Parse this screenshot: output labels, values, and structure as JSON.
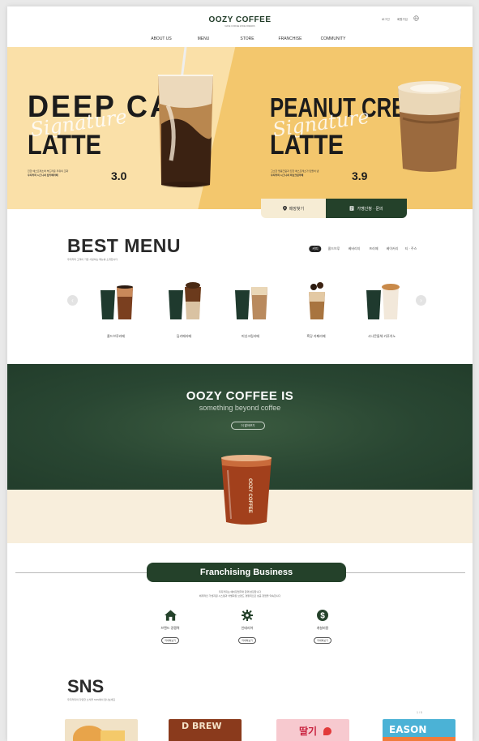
{
  "header": {
    "logo": "OOZY COFFEE",
    "logo_sub": "MAKE COFFEE ZONE FRIENDS",
    "util": [
      "로그인",
      "회원가입"
    ],
    "nav": [
      "ABOUT US",
      "MENU",
      "STORE",
      "FRANCHISE",
      "COMMUNITY"
    ]
  },
  "hero": {
    "slide1": {
      "title_line1": "DEEP CAFE",
      "title_line2": "LATTE",
      "script": "Signature",
      "desc_line1": "진한 에스프레소와 부드러운 우유의 조화",
      "desc_line2": "우지커피 시그니처 딥카페라떼",
      "price": "3.0"
    },
    "slide2": {
      "title_line1": "PEANUT CREAM",
      "title_line2": "LATTE",
      "script": "Signature",
      "desc_line1": "고소한 땅콩크림과 진한 에스프레소가 만들어 낸",
      "desc_line2": "우지커피 시그니처 피넛크림라떼",
      "price": "3.9"
    },
    "slider_active": 1,
    "store_find": "매장찾기",
    "franchise_inquiry": "가맹신청 · 문의"
  },
  "best_menu": {
    "title": "BEST MENU",
    "subtitle": "우지커피 고객이 가장 사랑하는 메뉴를 소개합니다",
    "tabs": [
      "커피",
      "콜드브루",
      "베버리지",
      "프라페",
      "베이커리",
      "티 · 주스"
    ],
    "active_tab": 0,
    "products": [
      {
        "name": "콜드브루라떼"
      },
      {
        "name": "딥카페라떼"
      },
      {
        "name": "피넛크림라떼"
      },
      {
        "name": "흑당 카페라떼"
      },
      {
        "name": "시나몬돌체 카푸치노"
      }
    ]
  },
  "about": {
    "title": "OOZY COFFEE IS",
    "subtitle": "something beyond coffee",
    "button": "더 알아보기",
    "cup_label": "OOZY COFFEE"
  },
  "franchising": {
    "title": "Franchising Business",
    "desc_line1": "우지커피는 예비창업주와 함께 성장합니다",
    "desc_line2": "체계적인 가맹지원 시스템과 차별화된 브랜드 경쟁력으로 성공 창업을 약속합니다",
    "items": [
      {
        "label": "브랜드 경쟁력",
        "button": "자세히보기",
        "icon": "home-icon"
      },
      {
        "label": "인테리어",
        "button": "자세히보기",
        "icon": "gear-icon"
      },
      {
        "label": "개설비용",
        "button": "자세히보기",
        "icon": "dollar-icon"
      }
    ]
  },
  "sns": {
    "title": "SNS",
    "subtitle": "우지커피의 다양한 소식을 SNS에서 만나보세요",
    "counter": "1 / 5",
    "cards": [
      {
        "text": ""
      },
      {
        "text": "D BREW"
      },
      {
        "text": "딸기"
      },
      {
        "text": "EASON"
      }
    ]
  },
  "colors": {
    "green": "#24412a",
    "hero_left": "#fae0a8",
    "hero_right": "#f3c76d",
    "cream": "#f8eedc"
  }
}
